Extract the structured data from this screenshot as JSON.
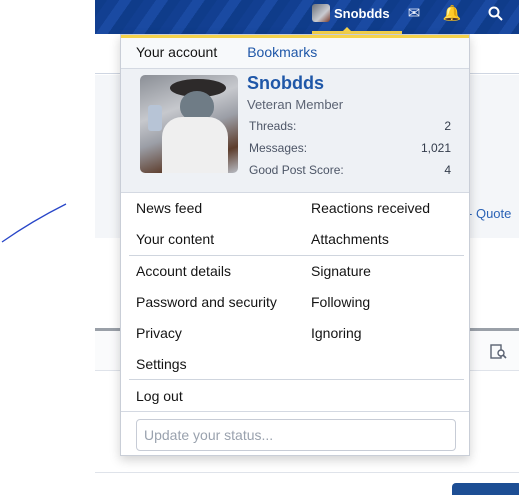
{
  "header": {
    "username": "Snobdds",
    "icons": [
      "mail-icon",
      "bell-icon",
      "search-icon"
    ]
  },
  "page": {
    "quote_label": "Quote"
  },
  "menu": {
    "tabs": [
      {
        "label": "Your account"
      },
      {
        "label": "Bookmarks"
      }
    ],
    "profile": {
      "name": "Snobdds",
      "title": "Veteran Member",
      "stats": [
        {
          "label": "Threads:",
          "value": "2"
        },
        {
          "label": "Messages:",
          "value": "1,021"
        },
        {
          "label": "Good Post Score:",
          "value": "4"
        }
      ]
    },
    "links_group1": [
      {
        "left": "News feed",
        "right": "Reactions received"
      },
      {
        "left": "Your content",
        "right": "Attachments"
      }
    ],
    "links_group2": [
      {
        "left": "Account details",
        "right": "Signature"
      },
      {
        "left": "Password and security",
        "right": "Following"
      },
      {
        "left": "Privacy",
        "right": "Ignoring"
      },
      {
        "left": "Settings",
        "right": ""
      }
    ],
    "logout_label": "Log out",
    "status_placeholder": "Update your status..."
  },
  "colors": {
    "accent": "#f5d24a",
    "header_blue": "#123f91",
    "link_blue": "#1f57a8"
  }
}
